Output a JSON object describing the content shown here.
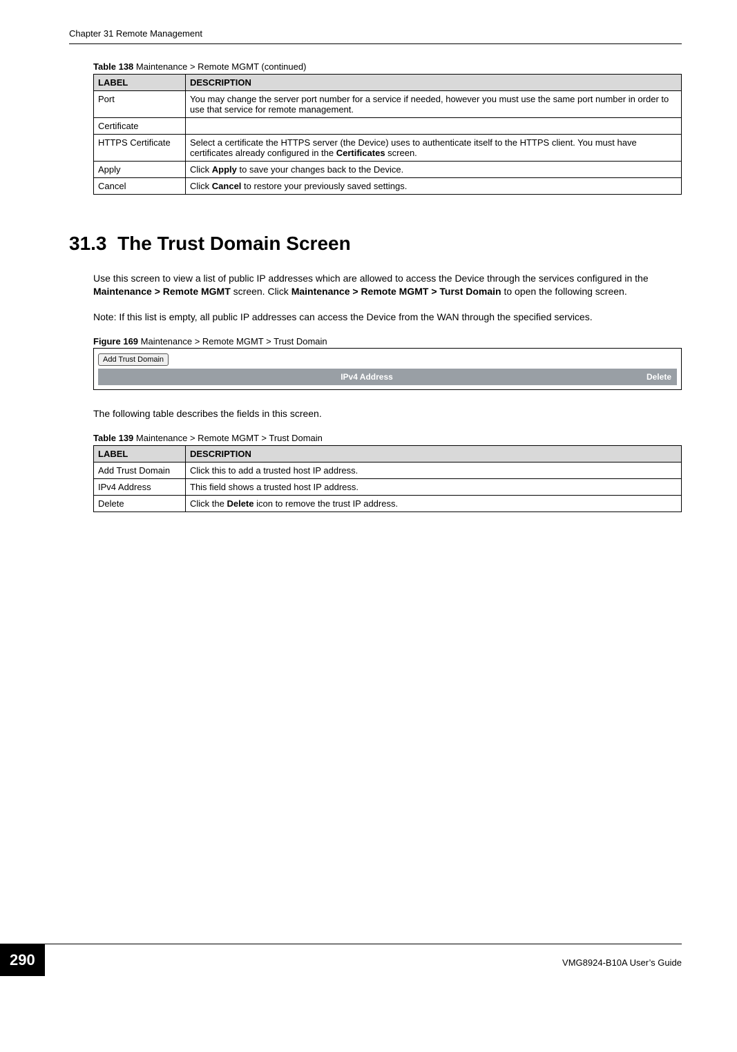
{
  "header": {
    "chapter": "Chapter 31 Remote Management"
  },
  "table138": {
    "caption_label": "Table 138",
    "caption_text": "Maintenance > Remote MGMT  (continued)",
    "headers": {
      "label": "LABEL",
      "description": "DESCRIPTION"
    },
    "rows": [
      {
        "label": "Port",
        "description_plain": "You may change the server port number for a service if needed, however you must use the same port number in order to use that service for remote management."
      },
      {
        "label": "Certificate",
        "description_plain": ""
      },
      {
        "label": "HTTPS Certificate",
        "description_pre": "Select a certificate the HTTPS server (the Device) uses to authenticate itself to the HTTPS client. You must have certificates already configured in the ",
        "description_bold": "Certificates",
        "description_post": " screen."
      },
      {
        "label": "Apply",
        "description_pre": "Click ",
        "description_bold": "Apply",
        "description_post": " to save your changes back to the Device."
      },
      {
        "label": "Cancel",
        "description_pre": "Click ",
        "description_bold": "Cancel",
        "description_post": " to restore your previously saved settings."
      }
    ]
  },
  "section": {
    "number": "31.3",
    "title": "The Trust Domain Screen",
    "intro_pre": "Use this screen to view a list of public IP addresses which are allowed to access the Device through the services configured in the ",
    "intro_bold1": "Maintenance > Remote MGMT",
    "intro_mid": " screen. Click ",
    "intro_bold2": "Maintenance > Remote MGMT > Turst Domain",
    "intro_post": " to open the following screen.",
    "note": "Note: If this list is empty, all public IP addresses can access the Device from the WAN through the specified services."
  },
  "figure169": {
    "caption_label": "Figure 169",
    "caption_text": "Maintenance > Remote MGMT > Trust Domain",
    "button": "Add Trust Domain",
    "col_addr": "IPv4 Address",
    "col_delete": "Delete"
  },
  "paragraph_after_figure": "The following table describes the fields in this screen.",
  "table139": {
    "caption_label": "Table 139",
    "caption_text": "Maintenance > Remote MGMT > Trust Domain",
    "headers": {
      "label": "LABEL",
      "description": "DESCRIPTION"
    },
    "rows": [
      {
        "label": "Add Trust Domain",
        "description_plain": "Click this to add a trusted host IP address."
      },
      {
        "label": "IPv4 Address",
        "description_plain": "This field shows a trusted host IP address."
      },
      {
        "label": "Delete",
        "description_pre": "Click the ",
        "description_bold": "Delete",
        "description_post": " icon to remove the trust IP address."
      }
    ]
  },
  "footer": {
    "page_number": "290",
    "guide": "VMG8924-B10A User’s Guide"
  }
}
